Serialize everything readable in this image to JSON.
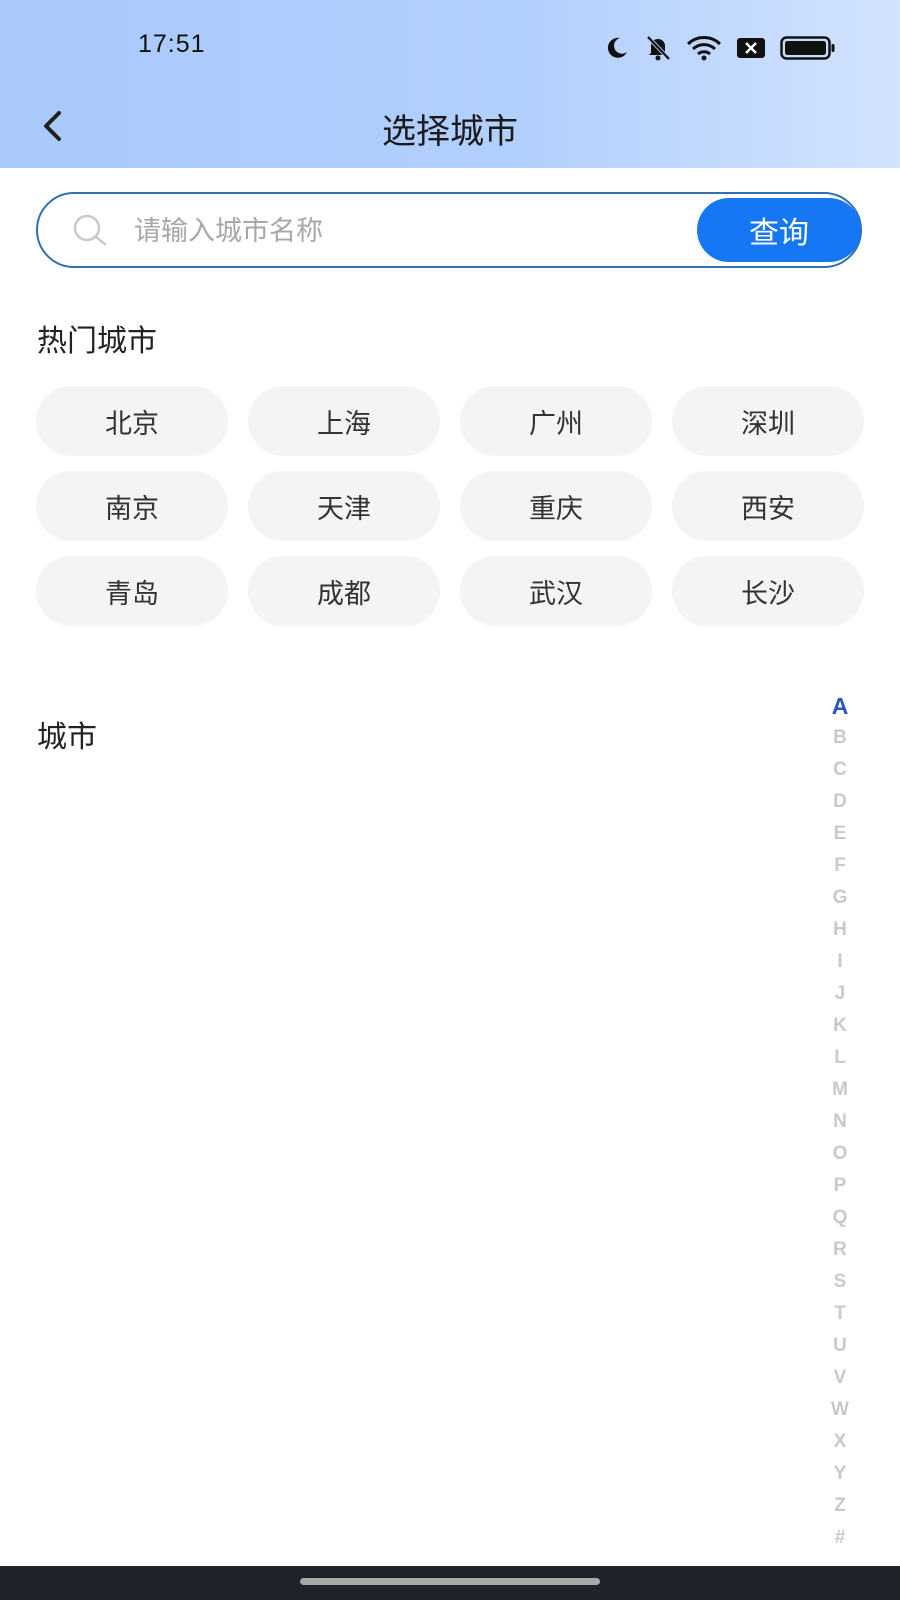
{
  "status_bar": {
    "time": "17:51",
    "icons": [
      "moon-icon",
      "bell-muted-icon",
      "wifi-icon",
      "sim-x-icon",
      "battery-icon"
    ]
  },
  "nav": {
    "back_icon": "chevron-left-icon",
    "title": "选择城市"
  },
  "search": {
    "placeholder": "请输入城市名称",
    "value": "",
    "button_label": "查询",
    "icon": "search-icon"
  },
  "hot_cities": {
    "title": "热门城市",
    "items": [
      "北京",
      "上海",
      "广州",
      "深圳",
      "南京",
      "天津",
      "重庆",
      "西安",
      "青岛",
      "成都",
      "武汉",
      "长沙"
    ]
  },
  "cities": {
    "title": "城市"
  },
  "alpha_index": {
    "active": "A",
    "letters": [
      "A",
      "B",
      "C",
      "D",
      "E",
      "F",
      "G",
      "H",
      "I",
      "J",
      "K",
      "L",
      "M",
      "N",
      "O",
      "P",
      "Q",
      "R",
      "S",
      "T",
      "U",
      "V",
      "W",
      "X",
      "Y",
      "Z",
      "#"
    ]
  },
  "colors": {
    "accent": "#1677f5",
    "index_active": "#2c55b8",
    "chip_bg": "#f4f4f4",
    "header_gradient_start": "#a9c9fb",
    "header_gradient_end": "#d2e3ff"
  }
}
